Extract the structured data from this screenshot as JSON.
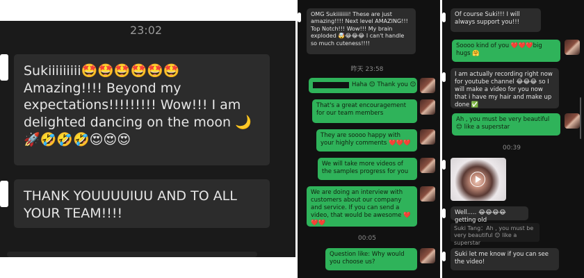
{
  "left": {
    "time": "23:02",
    "messages": [
      {
        "text": "Sukiiiiiiiii🤩🤩🤩🤩🤩🤩 Amazing!!!! Beyond my expectations!!!!!!!!! Wow!!! I am delighted dancing on the moon 🌙🚀🤣🤣🤣😍😍😍"
      },
      {
        "text": "THANK YOUUUUIUU AND TO ALL YOUR TEAM!!!!"
      }
    ]
  },
  "middle": {
    "top_message": "OMG Sukiiiiiiii! These are just amazing!!!! Next level AMAZING!!! Top Notch!!! Wow!!! My brain exploded 🤯😂😂😂 I can't handle so much cuteness!!!!",
    "time_1": "昨天 23:58",
    "messages": [
      {
        "text": "Haha 😊 Thank you 😊"
      },
      {
        "text": "That's a great encouragement for our team members"
      },
      {
        "text": "They are soooo happy with your highly comments ❤️❤️❤️"
      },
      {
        "text": "We will take more videos of the samples progress for you"
      },
      {
        "text": "We are doing an interview with customers about our company and service. If you can send a video, that would be awesome ❤️❤️❤️"
      }
    ],
    "time_2": "00:05",
    "last_message": "Question like: Why would you choose us?"
  },
  "right": {
    "messages": [
      {
        "text": "Of course Suki!!! I will always support you!!!"
      },
      {
        "text": "Soooo kind of you ❤️❤️❤️big hugs 🤗"
      },
      {
        "text": "I am actually recording right now for youtube channel 😂😂😂 so I will make a video for you now that i have my hair and make up done ✅"
      },
      {
        "text": "Ah , you must be very beautiful 😊 like a superstar"
      }
    ],
    "time": "00:39",
    "after_video": "Well..... 😂😂😂😂 getting old",
    "recall": "Suki Tang：Ah , you must be very beautiful 😊 like a superstar",
    "final": "Suki let me know if you can see the video!"
  },
  "colors": {
    "green_bubble": "#2fb35a",
    "gray_bubble": "#2c2c2c",
    "background": "#1a1a1a"
  }
}
